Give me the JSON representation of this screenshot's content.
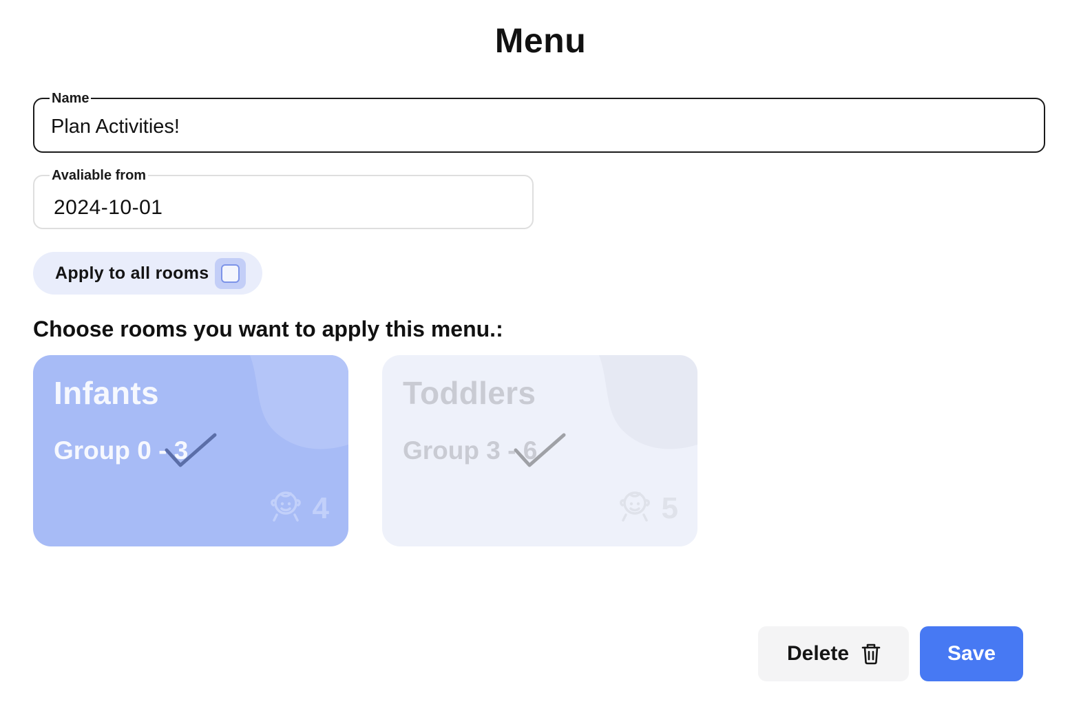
{
  "page": {
    "title": "Menu"
  },
  "form": {
    "name": {
      "label": "Name",
      "value": "Plan Activities!"
    },
    "available_from": {
      "label": "Avaliable from",
      "value": "2024-10-01"
    },
    "apply_all": {
      "label": "Apply to all rooms",
      "checked": false
    }
  },
  "rooms_section": {
    "heading": "Choose rooms you want to apply this menu.:",
    "rooms": [
      {
        "name": "Infants",
        "group": "Group 0 - 3",
        "count": "4",
        "selected": true,
        "icon": "baby-icon",
        "color": "#a7bbf6"
      },
      {
        "name": "Toddlers",
        "group": "Group 3 - 6",
        "count": "5",
        "selected": false,
        "icon": "baby-icon",
        "color": "#eef1fa"
      }
    ]
  },
  "actions": {
    "delete_label": "Delete",
    "delete_icon": "trash-icon",
    "save_label": "Save",
    "save_color": "#4779f3"
  }
}
